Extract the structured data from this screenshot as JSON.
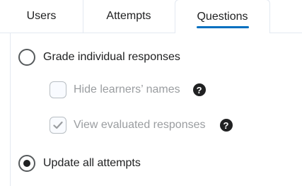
{
  "tabs": [
    {
      "label": "Users"
    },
    {
      "label": "Attempts"
    },
    {
      "label": "Questions"
    }
  ],
  "options": {
    "grade_individual": {
      "label": "Grade individual responses",
      "selected": false
    },
    "hide_names": {
      "label": "Hide learners’ names",
      "checked": false,
      "disabled": true
    },
    "view_evaluated": {
      "label": "View evaluated responses",
      "checked": true,
      "disabled": true
    },
    "update_all": {
      "label": "Update all attempts",
      "selected": true
    }
  },
  "help_glyph": "?",
  "colors": {
    "accent": "#006fbf",
    "text": "#202122",
    "disabled_text": "#9a9da0",
    "border": "#e3e9f1"
  }
}
